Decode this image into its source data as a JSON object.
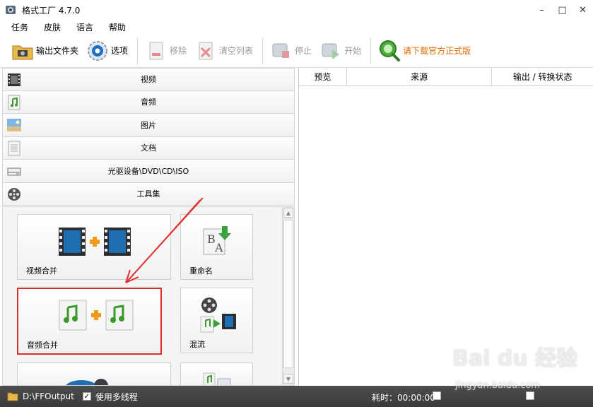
{
  "window": {
    "title": "格式工厂 4.7.0",
    "controls": {
      "minimize": "–",
      "maximize": "□",
      "close": "✕"
    }
  },
  "menu": [
    "任务",
    "皮肤",
    "语言",
    "帮助"
  ],
  "toolbar": {
    "output_folder": "输出文件夹",
    "options": "选项",
    "remove": "移除",
    "clear_list": "清空列表",
    "stop": "停止",
    "start": "开始",
    "download_official": "请下载官方正式版"
  },
  "categories": [
    "视频",
    "音频",
    "图片",
    "文档",
    "光驱设备\\DVD\\CD\\ISO",
    "工具集"
  ],
  "tools": {
    "video_merge": "视频合并",
    "rename": "重命名",
    "audio_merge": "音频合并",
    "mux": "混流"
  },
  "queue_columns": [
    "预览",
    "来源",
    "输出 / 转换状态"
  ],
  "status": {
    "output_path": "D:\\FFOutput",
    "multithread": "使用多线程",
    "elapsed": "耗时：00:00:00"
  },
  "watermark": {
    "brand": "Bai du 经验",
    "url": "jingyan.baidu.com"
  },
  "colors": {
    "highlight": "#d83030",
    "promo": "#e06a00",
    "statusbar": "#404040"
  }
}
